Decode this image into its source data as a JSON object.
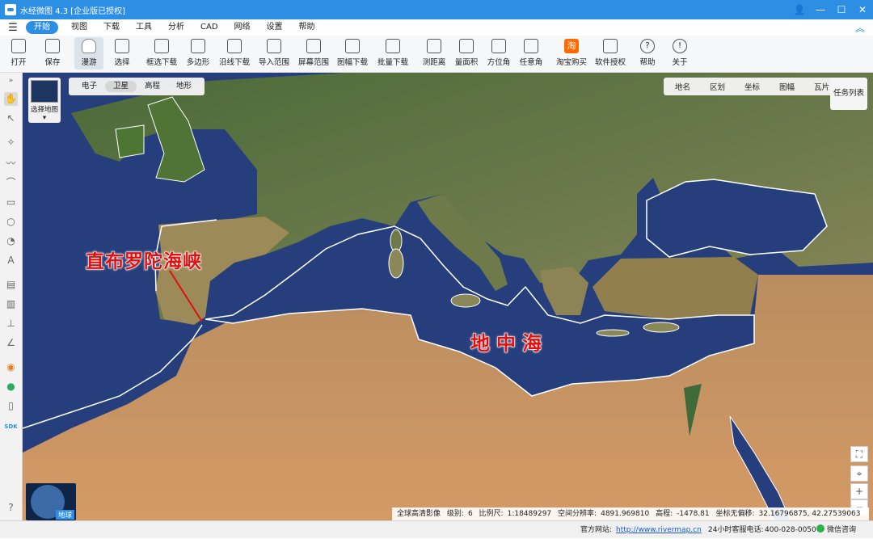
{
  "window": {
    "title": "水经微图 4.3 [企业版已授权]",
    "controls": [
      "👤",
      "—",
      "☐",
      "✕"
    ]
  },
  "menu": {
    "items": [
      "开始",
      "视图",
      "下载",
      "工具",
      "分析",
      "CAD",
      "网络",
      "设置",
      "帮助"
    ],
    "active": "开始"
  },
  "toolbar": {
    "items": [
      {
        "label": "打开",
        "icon": "folder-icon"
      },
      {
        "label": "保存",
        "icon": "save-icon"
      },
      {
        "label": "漫游",
        "icon": "hand-icon",
        "selected": true
      },
      {
        "label": "选择",
        "icon": "pointer-icon"
      },
      {
        "label": "框选下载",
        "icon": "box-download-icon"
      },
      {
        "label": "多边形",
        "icon": "polygon-icon"
      },
      {
        "label": "沿线下载",
        "icon": "line-download-icon"
      },
      {
        "label": "导入范围",
        "icon": "import-range-icon"
      },
      {
        "label": "屏幕范围",
        "icon": "screen-range-icon"
      },
      {
        "label": "图幅下载",
        "icon": "sheet-download-icon"
      },
      {
        "label": "批量下载",
        "icon": "batch-download-icon"
      },
      {
        "label": "测距离",
        "icon": "ruler-icon"
      },
      {
        "label": "量面积",
        "icon": "area-icon"
      },
      {
        "label": "方位角",
        "icon": "azimuth-icon"
      },
      {
        "label": "任意角",
        "icon": "angle-icon"
      },
      {
        "label": "淘宝购买",
        "icon": "taobao-icon",
        "glyph": "淘"
      },
      {
        "label": "软件授权",
        "icon": "lock-icon"
      },
      {
        "label": "帮助",
        "icon": "help-icon",
        "glyph": "?"
      },
      {
        "label": "关于",
        "icon": "info-icon",
        "glyph": "!"
      }
    ]
  },
  "map": {
    "types": [
      "电子",
      "卫星",
      "高程",
      "地形"
    ],
    "active_type": "卫星",
    "select_map_label": "选择地图",
    "layers": [
      "地名",
      "区划",
      "坐标",
      "图幅",
      "瓦片"
    ],
    "task_list": "任务列表",
    "globe_label": "地球",
    "annotations": {
      "strait": "直布罗陀海峡",
      "sea": "地中海"
    }
  },
  "info": {
    "imagery": "全球高清影像",
    "level_label": "级别:",
    "level": "6",
    "scale_label": "比例尺:",
    "scale": "1:18489297",
    "resolution_label": "空间分辨率:",
    "resolution": "4891.969810",
    "elevation_label": "高程:",
    "elevation": "-1478.81",
    "coord_label": "坐标无偏移:",
    "coords": "32.16796875, 42.27539063"
  },
  "status": {
    "site_label": "官方网站:",
    "site_url": "http://www.rivermap.cn",
    "service_label": "24小时客服电话:",
    "phone": "400-028-0050",
    "wechat": "微信咨询"
  }
}
